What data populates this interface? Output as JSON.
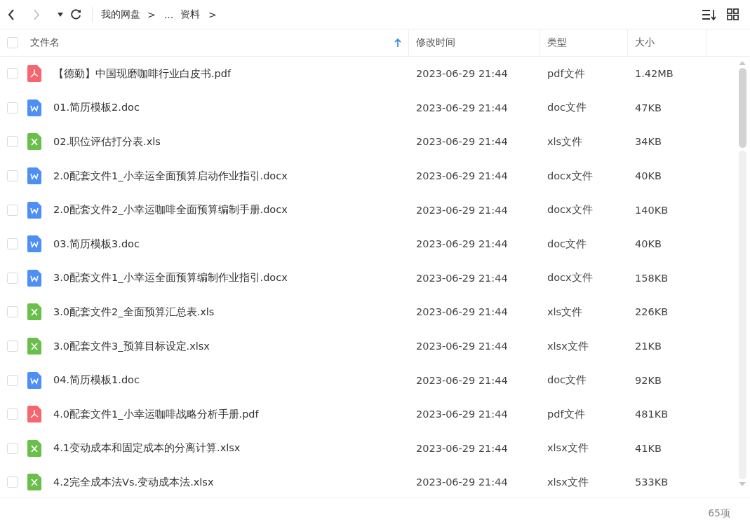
{
  "breadcrumb": [
    "我的网盘",
    ">",
    "...",
    "资料",
    ">"
  ],
  "columns": [
    {
      "label": "文件名",
      "sorted": true
    },
    {
      "label": "修改时间",
      "sorted": false
    },
    {
      "label": "类型",
      "sorted": false
    },
    {
      "label": "大小",
      "sorted": false
    }
  ],
  "header_checked": false,
  "rows": [
    {
      "kind": "pdf",
      "name": "【德勤】中国现磨咖啡行业白皮书.pdf",
      "modified": "2023-06-29 21:44",
      "type": "pdf文件",
      "size": "1.42MB",
      "checked": false
    },
    {
      "kind": "doc",
      "name": "01.简历模板2.doc",
      "modified": "2023-06-29 21:44",
      "type": "doc文件",
      "size": "47KB",
      "checked": false
    },
    {
      "kind": "xls",
      "name": "02.职位评估打分表.xls",
      "modified": "2023-06-29 21:44",
      "type": "xls文件",
      "size": "34KB",
      "checked": false
    },
    {
      "kind": "doc",
      "name": "2.0配套文件1_小幸运全面预算启动作业指引.docx",
      "modified": "2023-06-29 21:44",
      "type": "docx文件",
      "size": "40KB",
      "checked": false
    },
    {
      "kind": "doc",
      "name": "2.0配套文件2_小幸运咖啡全面预算编制手册.docx",
      "modified": "2023-06-29 21:44",
      "type": "docx文件",
      "size": "140KB",
      "checked": false
    },
    {
      "kind": "doc",
      "name": "03.简历模板3.doc",
      "modified": "2023-06-29 21:44",
      "type": "doc文件",
      "size": "40KB",
      "checked": false
    },
    {
      "kind": "doc",
      "name": "3.0配套文件1_小幸运全面预算编制作业指引.docx",
      "modified": "2023-06-29 21:44",
      "type": "docx文件",
      "size": "158KB",
      "checked": false
    },
    {
      "kind": "xls",
      "name": "3.0配套文件2_全面预算汇总表.xls",
      "modified": "2023-06-29 21:44",
      "type": "xls文件",
      "size": "226KB",
      "checked": false
    },
    {
      "kind": "xls",
      "name": "3.0配套文件3_预算目标设定.xlsx",
      "modified": "2023-06-29 21:44",
      "type": "xlsx文件",
      "size": "21KB",
      "checked": false
    },
    {
      "kind": "doc",
      "name": "04.简历模板1.doc",
      "modified": "2023-06-29 21:44",
      "type": "doc文件",
      "size": "92KB",
      "checked": false
    },
    {
      "kind": "pdf",
      "name": "4.0配套文件1_小幸运咖啡战略分析手册.pdf",
      "modified": "2023-06-29 21:44",
      "type": "pdf文件",
      "size": "481KB",
      "checked": false
    },
    {
      "kind": "xls",
      "name": "4.1变动成本和固定成本的分离计算.xlsx",
      "modified": "2023-06-29 21:44",
      "type": "xlsx文件",
      "size": "41KB",
      "checked": false
    },
    {
      "kind": "xls",
      "name": "4.2完全成本法Vs.变动成本法.xlsx",
      "modified": "2023-06-29 21:44",
      "type": "xlsx文件",
      "size": "533KB",
      "checked": false
    }
  ],
  "item_count": "65项"
}
